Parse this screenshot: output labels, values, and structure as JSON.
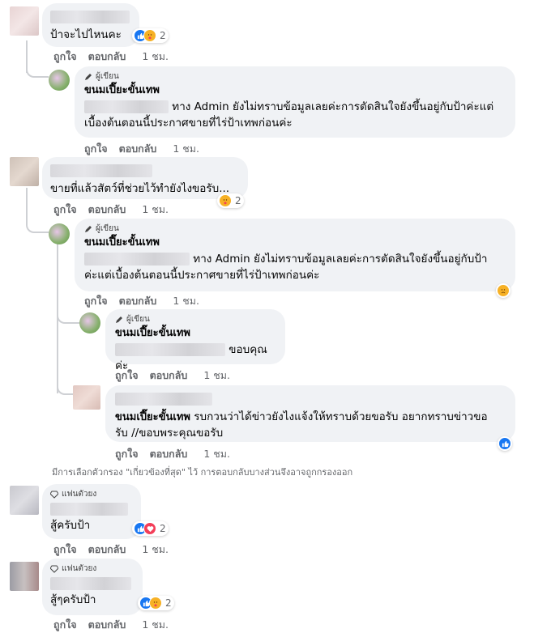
{
  "actions": {
    "like": "ถูกใจ",
    "reply": "ตอบกลับ"
  },
  "comments": [
    {
      "text": "ป้าจะไปไหนคะ",
      "reactions": "2",
      "time": "1 ชม."
    },
    {
      "badge": "ผู้เขียน",
      "name": "ขนมเปี๊ยะขั้นเทพ",
      "text1": "ทาง Admin ยังไม่ทราบข้อมูลเลยค่ะการตัดสินใจยังขึ้นอยู่กับป้าค่ะแต่",
      "text2": "เบื้องต้นตอนนี้ประกาศขายที่ไร่ป้าเทพก่อนค่ะ",
      "time": "1 ชม."
    },
    {
      "text": "ขายที่แล้วสัตว์ที่ช่วยไว้ทำยังไงขอรับ...",
      "reactions": "2",
      "time": "1 ชม."
    },
    {
      "badge": "ผู้เขียน",
      "name": "ขนมเปี๊ยะขั้นเทพ",
      "text1": "ทาง Admin ยังไม่ทราบข้อมูลเลยค่ะการตัดสินใจยังขึ้นอยู่กับป้า",
      "text2": "ค่ะแต่เบื้องต้นตอนนี้ประกาศขายที่ไร่ป้าเทพก่อนค่ะ",
      "time": "1 ชม."
    },
    {
      "badge": "ผู้เขียน",
      "name": "ขนมเปี๊ยะขั้นเทพ",
      "text": "ขอบคุณค่ะ",
      "time": "1 ชม."
    },
    {
      "mention": "ขนมเปี๊ยะขั้นเทพ",
      "text1": "รบกวนว่าได้ข่าวยังไงแจ้งให้ทราบด้วยขอรับ อยากทราบข่าวขอ",
      "text2": "รับ //ขอบพระคุณขอรับ",
      "time": "1 ชม."
    },
    {
      "badge": "แฟนตัวยง",
      "text": "สู้ครับป้า",
      "reactions": "2",
      "time": "1 ชม."
    },
    {
      "badge": "แฟนตัวยง",
      "text": "สู้ๆครับป้า",
      "reactions": "2",
      "time": "1 ชม."
    }
  ],
  "filter_notice": "มีการเลือกตัวกรอง \"เกี่ยวข้องที่สุด\" ไว้ การตอบกลับบางส่วนจึงอาจถูกกรองออก",
  "colors": {
    "like": "#1877f2",
    "love": "#f33e58",
    "care": "#f7b125",
    "bubble": "#f0f2f5",
    "meta": "#65676b"
  },
  "icons": [
    "pencil-icon",
    "diamond-icon",
    "like-reaction-icon",
    "care-reaction-icon",
    "love-reaction-icon",
    "sad-reaction-icon"
  ]
}
